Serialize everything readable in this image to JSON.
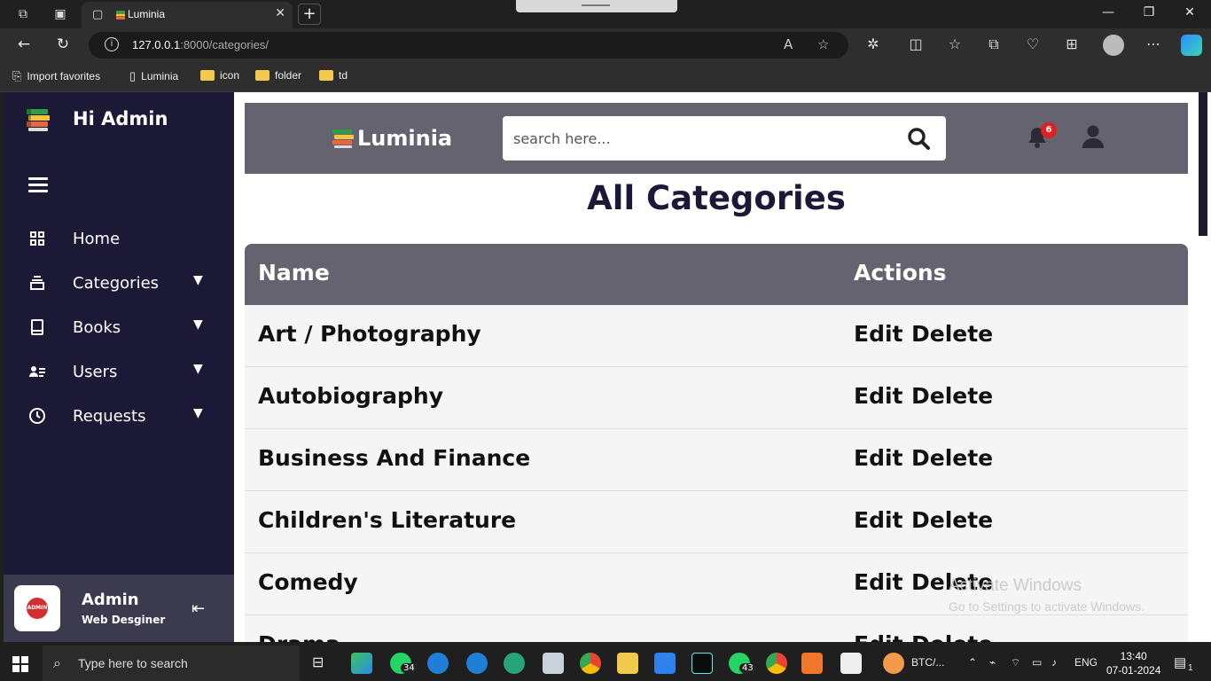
{
  "browser": {
    "tab_title": "Luminia",
    "url_host": "127.0.0.1",
    "url_path": ":8000/categories/",
    "favorites": [
      "Import favorites",
      "Luminia",
      "icon",
      "folder",
      "td"
    ]
  },
  "sidebar": {
    "greeting": "Hi Admin",
    "items": [
      {
        "label": "Home",
        "icon": "grid-icon"
      },
      {
        "label": "Categories",
        "icon": "stack-icon"
      },
      {
        "label": "Books",
        "icon": "book-icon"
      },
      {
        "label": "Users",
        "icon": "users-icon"
      },
      {
        "label": "Requests",
        "icon": "clock-icon"
      }
    ],
    "profile": {
      "name": "Admin",
      "role": "Web Desginer",
      "avatar_text": "ADMIN"
    }
  },
  "header": {
    "brand": "Luminia",
    "search_placeholder": "search here...",
    "notification_count": "6"
  },
  "main": {
    "title": "All Categories",
    "columns": [
      "Name",
      "Actions"
    ],
    "edit_label": "Edit",
    "delete_label": "Delete",
    "rows": [
      "Art / Photography",
      "Autobiography",
      "Business And Finance",
      "Children's Literature",
      "Comedy",
      "Drama"
    ]
  },
  "watermark": {
    "line1": "Activate Windows",
    "line2": "Go to Settings to activate Windows."
  },
  "taskbar": {
    "search_text": "Type here to search",
    "whatsapp_count": "34",
    "whatsapp2_count": "43",
    "app_label": "BTC/...",
    "lang": "ENG",
    "time": "13:40",
    "date": "07-01-2024",
    "notif_count": "1"
  }
}
